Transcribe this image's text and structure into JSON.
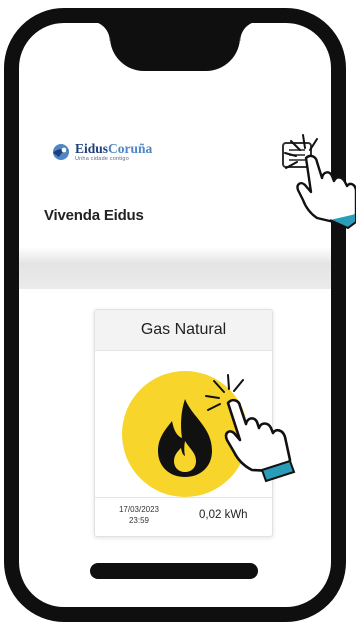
{
  "logo": {
    "name_dark": "Eidus",
    "name_light": "Coruña",
    "tagline": "Unha cidade contigo"
  },
  "page": {
    "title": "Vivenda Eidus"
  },
  "card": {
    "title": "Gas Natural",
    "icon": "flame-icon",
    "date_line1": "17/03/2023",
    "date_line2": "23:59",
    "value": "0,02 kWh"
  },
  "colors": {
    "frame": "#0f0f0f",
    "accent_yellow": "#f7d52b",
    "cuff_teal": "#2a9db8",
    "logo_blue": "#1d3f7a"
  },
  "illustration": [
    "hand-pointer-icon",
    "tap-burst-icon"
  ]
}
